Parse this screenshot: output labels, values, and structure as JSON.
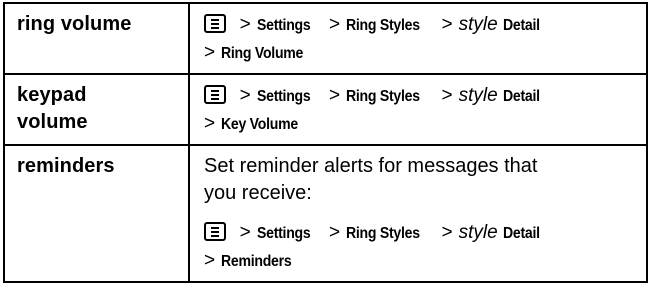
{
  "rows": [
    {
      "term": "ring volume",
      "path": {
        "menu_icon": "menu-key-icon",
        "settings": "Settings",
        "ring_styles": "Ring Styles",
        "style": "style",
        "detail": "Detail",
        "item": "Ring Volume"
      }
    },
    {
      "term": "keypad volume",
      "term_line1": "keypad",
      "term_line2": "volume",
      "path": {
        "menu_icon": "menu-key-icon",
        "settings": "Settings",
        "ring_styles": "Ring Styles",
        "style": "style",
        "detail": "Detail",
        "item": "Key Volume"
      }
    },
    {
      "term": "reminders",
      "description": "Set reminder alerts for messages that you receive:",
      "desc_line1": "Set reminder alerts for messages that",
      "desc_line2": "you receive:",
      "path": {
        "menu_icon": "menu-key-icon",
        "settings": "Settings",
        "ring_styles": "Ring Styles",
        "style": "style",
        "detail": "Detail",
        "item": "Reminders"
      }
    }
  ],
  "separator": ">"
}
